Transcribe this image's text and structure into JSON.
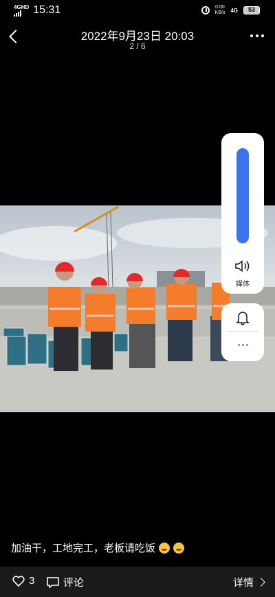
{
  "status": {
    "network": "4GHD",
    "time": "15:31",
    "speed": "0.00",
    "speed_unit": "KB/s",
    "net_type": "4G",
    "battery": "53"
  },
  "header": {
    "title": "2022年9月23日 20:03",
    "counter": "2 / 6"
  },
  "volume": {
    "level": 1.0,
    "label": "媒体"
  },
  "caption": {
    "text": "加油干，工地完工，老板请吃饭"
  },
  "footer": {
    "likes": "3",
    "comment_label": "评论",
    "details_label": "详情"
  },
  "colors": {
    "accent": "#3e73f0",
    "vest": "#f57c2a",
    "helmet": "#e12a2a"
  }
}
